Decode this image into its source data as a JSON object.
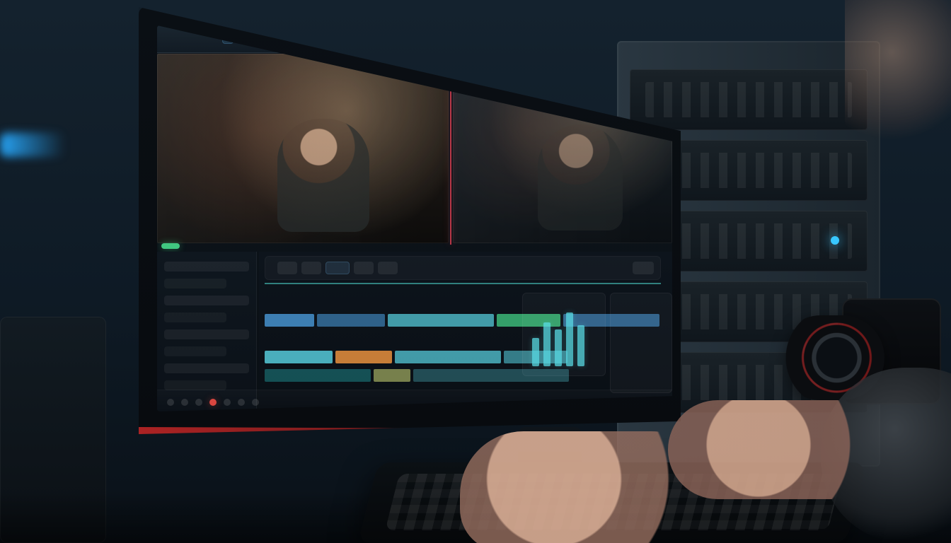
{
  "scene": {
    "description_tags": [
      "editor",
      "monitor",
      "timeline",
      "viewer",
      "server-rack",
      "camera",
      "keyboard",
      "hands"
    ]
  },
  "screen": {
    "tabs": [
      {
        "label": ""
      },
      {
        "label": ""
      },
      {
        "label": ""
      }
    ],
    "colors": {
      "accent_cyan": "#5AD6E6",
      "accent_blue": "#4DA3E6",
      "accent_orange": "#E8903E",
      "accent_green": "#46DC8C",
      "accent_red": "#FF4A5A"
    }
  }
}
